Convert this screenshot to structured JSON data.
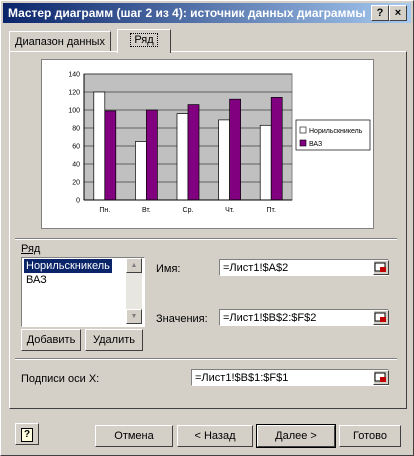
{
  "window": {
    "title": "Мастер диаграмм (шаг 2 из 4): источник данных диаграммы",
    "help_btn": "?",
    "close_btn": "×"
  },
  "tabs": [
    {
      "label": "Диапазон данных",
      "active": false
    },
    {
      "label": "Ряд",
      "active": true
    }
  ],
  "chart_data": {
    "type": "bar",
    "categories": [
      "Пн.",
      "Вт.",
      "Ср.",
      "Чт.",
      "Пт."
    ],
    "series": [
      {
        "name": "Норильскникель",
        "values": [
          120,
          65,
          96,
          89,
          83
        ],
        "color": "#ffffff"
      },
      {
        "name": "ВАЗ",
        "values": [
          99,
          100,
          106,
          112,
          114
        ],
        "color": "#800080"
      }
    ],
    "ylim": [
      0,
      140
    ],
    "yticks": [
      "0",
      "20",
      "40",
      "60",
      "80",
      "100",
      "120",
      "140"
    ],
    "grid": true,
    "plot_background": "#c0c0c0",
    "legend_position": "right"
  },
  "series_section": {
    "label": "Ряд",
    "items": [
      "Норильскникель",
      "ВАЗ"
    ],
    "selected_index": 0,
    "add_button": "Добавить",
    "delete_button": "Удалить"
  },
  "name_field": {
    "label": "Имя:",
    "value": "=Лист1!$A$2"
  },
  "values_field": {
    "label": "Значения:",
    "value": "=Лист1!$B$2:$F$2"
  },
  "xlabels_field": {
    "label": "Подписи оси X:",
    "value": "=Лист1!$B$1:$F$1"
  },
  "footer": {
    "help_icon": "?",
    "cancel": "Отмена",
    "back": "< Назад",
    "next": "Далее >",
    "finish": "Готово"
  }
}
